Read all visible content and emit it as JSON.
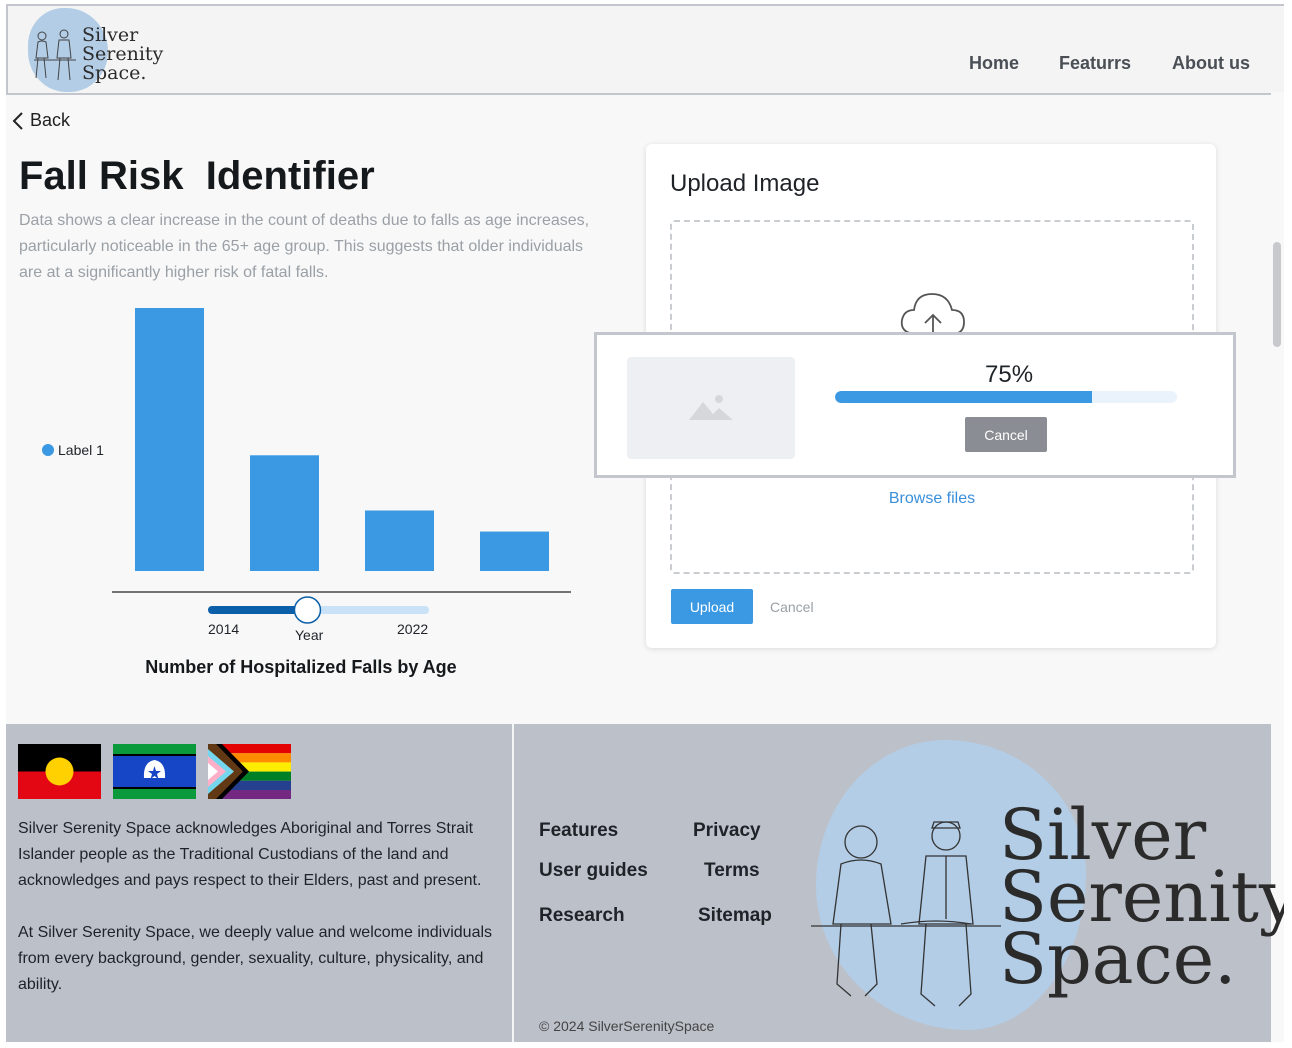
{
  "header": {
    "logo_lines": [
      "Silver",
      "Serenity",
      "Space."
    ],
    "nav": [
      "Home",
      "Featurrs",
      "About us"
    ]
  },
  "back_label": "Back",
  "page": {
    "title": "Fall Risk  Identifier",
    "description": "Data shows a clear increase in the count of deaths due to falls as age increases, particularly noticeable in the 65+ age group. This suggests that older individuals are at a significantly higher risk of fatal falls."
  },
  "chart_data": {
    "type": "bar",
    "title": "Number of Hospitalized Falls by Age",
    "legend": [
      "Label 1"
    ],
    "legend_position": "left",
    "series": [
      {
        "name": "Label 1",
        "values": [
          100,
          44,
          23,
          15
        ]
      }
    ],
    "ylim": [
      0,
      100
    ],
    "bar_color": "#3b99e3",
    "slider": {
      "min_label": "2014",
      "max_label": "2022",
      "label": "Year",
      "value": 0.45
    }
  },
  "upload": {
    "title": "Upload Image",
    "browse": "Browse files",
    "upload_button": "Upload",
    "cancel_link": "Cancel"
  },
  "progress": {
    "percent_text": "75%",
    "value": 0.75,
    "cancel_button": "Cancel"
  },
  "footer": {
    "ack1": "Silver Serenity Space acknowledges Aboriginal and Torres Strait Islander people as the Traditional Custodians of the land  and acknowledges and pays respect to their Elders, past and present.",
    "ack2": "At Silver Serenity Space, we deeply value and welcome individuals from every background, gender, sexuality, culture, physicality, and ability.",
    "links_col1": [
      "Features",
      "User guides",
      "Research"
    ],
    "links_col2": [
      "Privacy",
      "Terms",
      "Sitemap"
    ],
    "copyright": "© 2024 SilverSerenitySpace",
    "logo_lines": [
      "Silver",
      "Serenity",
      "Space."
    ]
  },
  "colors": {
    "accent": "#3b99e3",
    "footer_bg": "#bcc0c9",
    "logo_blob": "#b3cde6"
  }
}
